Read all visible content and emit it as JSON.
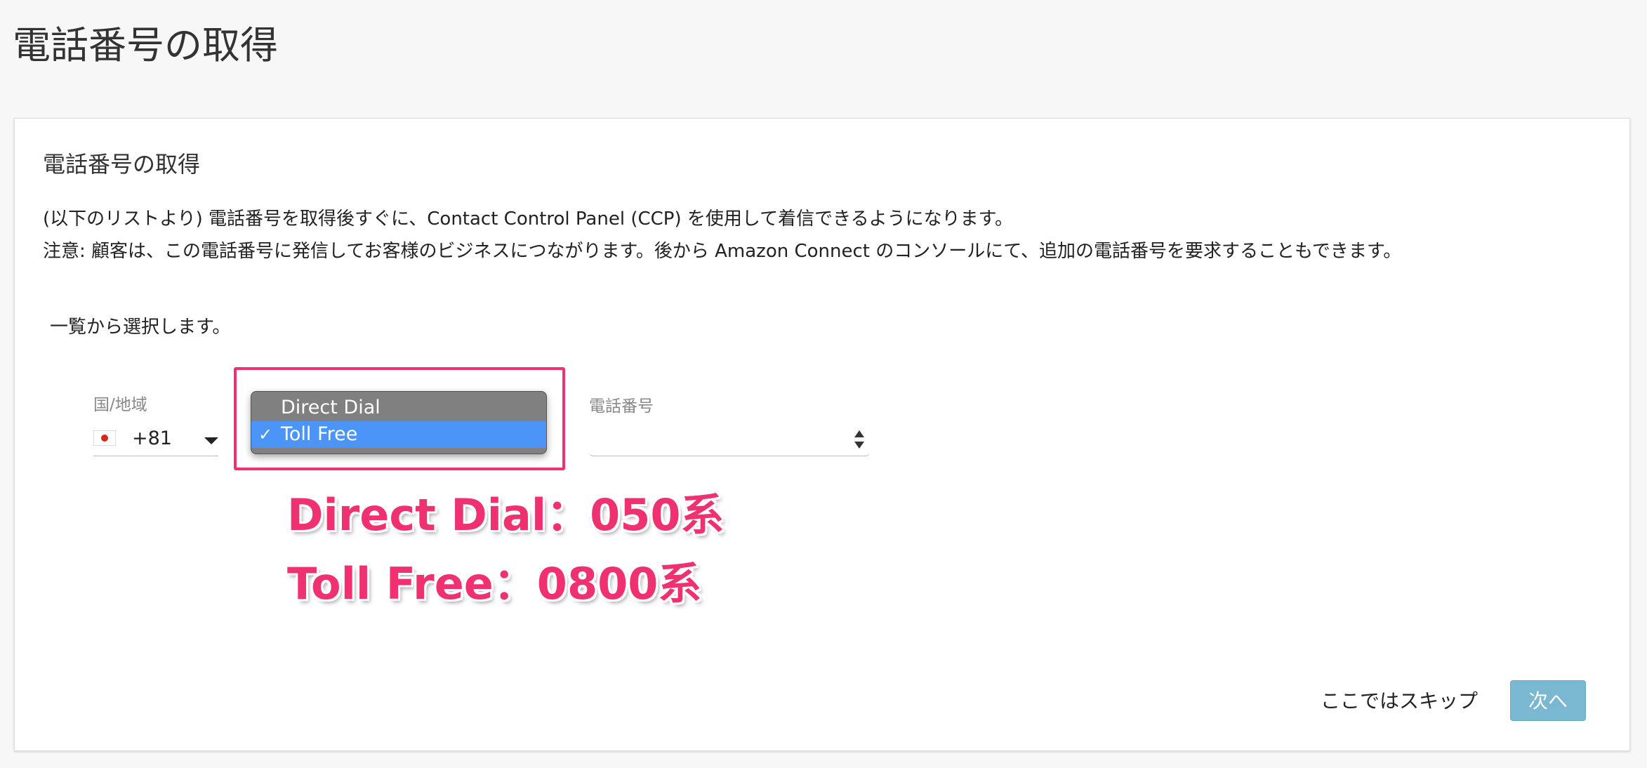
{
  "page": {
    "title": "電話番号の取得"
  },
  "panel": {
    "title": "電話番号の取得",
    "description_line1": "(以下のリストより) 電話番号を取得後すぐに、Contact Control Panel (CCP) を使用して着信できるようになります。",
    "description_line2": "注意: 顧客は、この電話番号に発信してお客様のビジネスにつながります。後から Amazon Connect のコンソールにて、追加の電話番号を要求することもできます。",
    "select_label": "一覧から選択します。"
  },
  "form": {
    "country_label": "国/地域",
    "country_code": "+81",
    "country_flag": "japan-flag-icon",
    "phone_label": "電話番号",
    "phone_value": "",
    "type_options": [
      "Direct Dial",
      "Toll Free"
    ],
    "type_selected": "Toll Free",
    "checkmark": "✓"
  },
  "annotations": {
    "line1": "Direct Dial：050系",
    "line2": "Toll Free：0800系",
    "color": "#f0316f"
  },
  "footer": {
    "skip_label": "ここではスキップ",
    "next_label": "次へ",
    "next_button_color": "#79b8d0"
  }
}
